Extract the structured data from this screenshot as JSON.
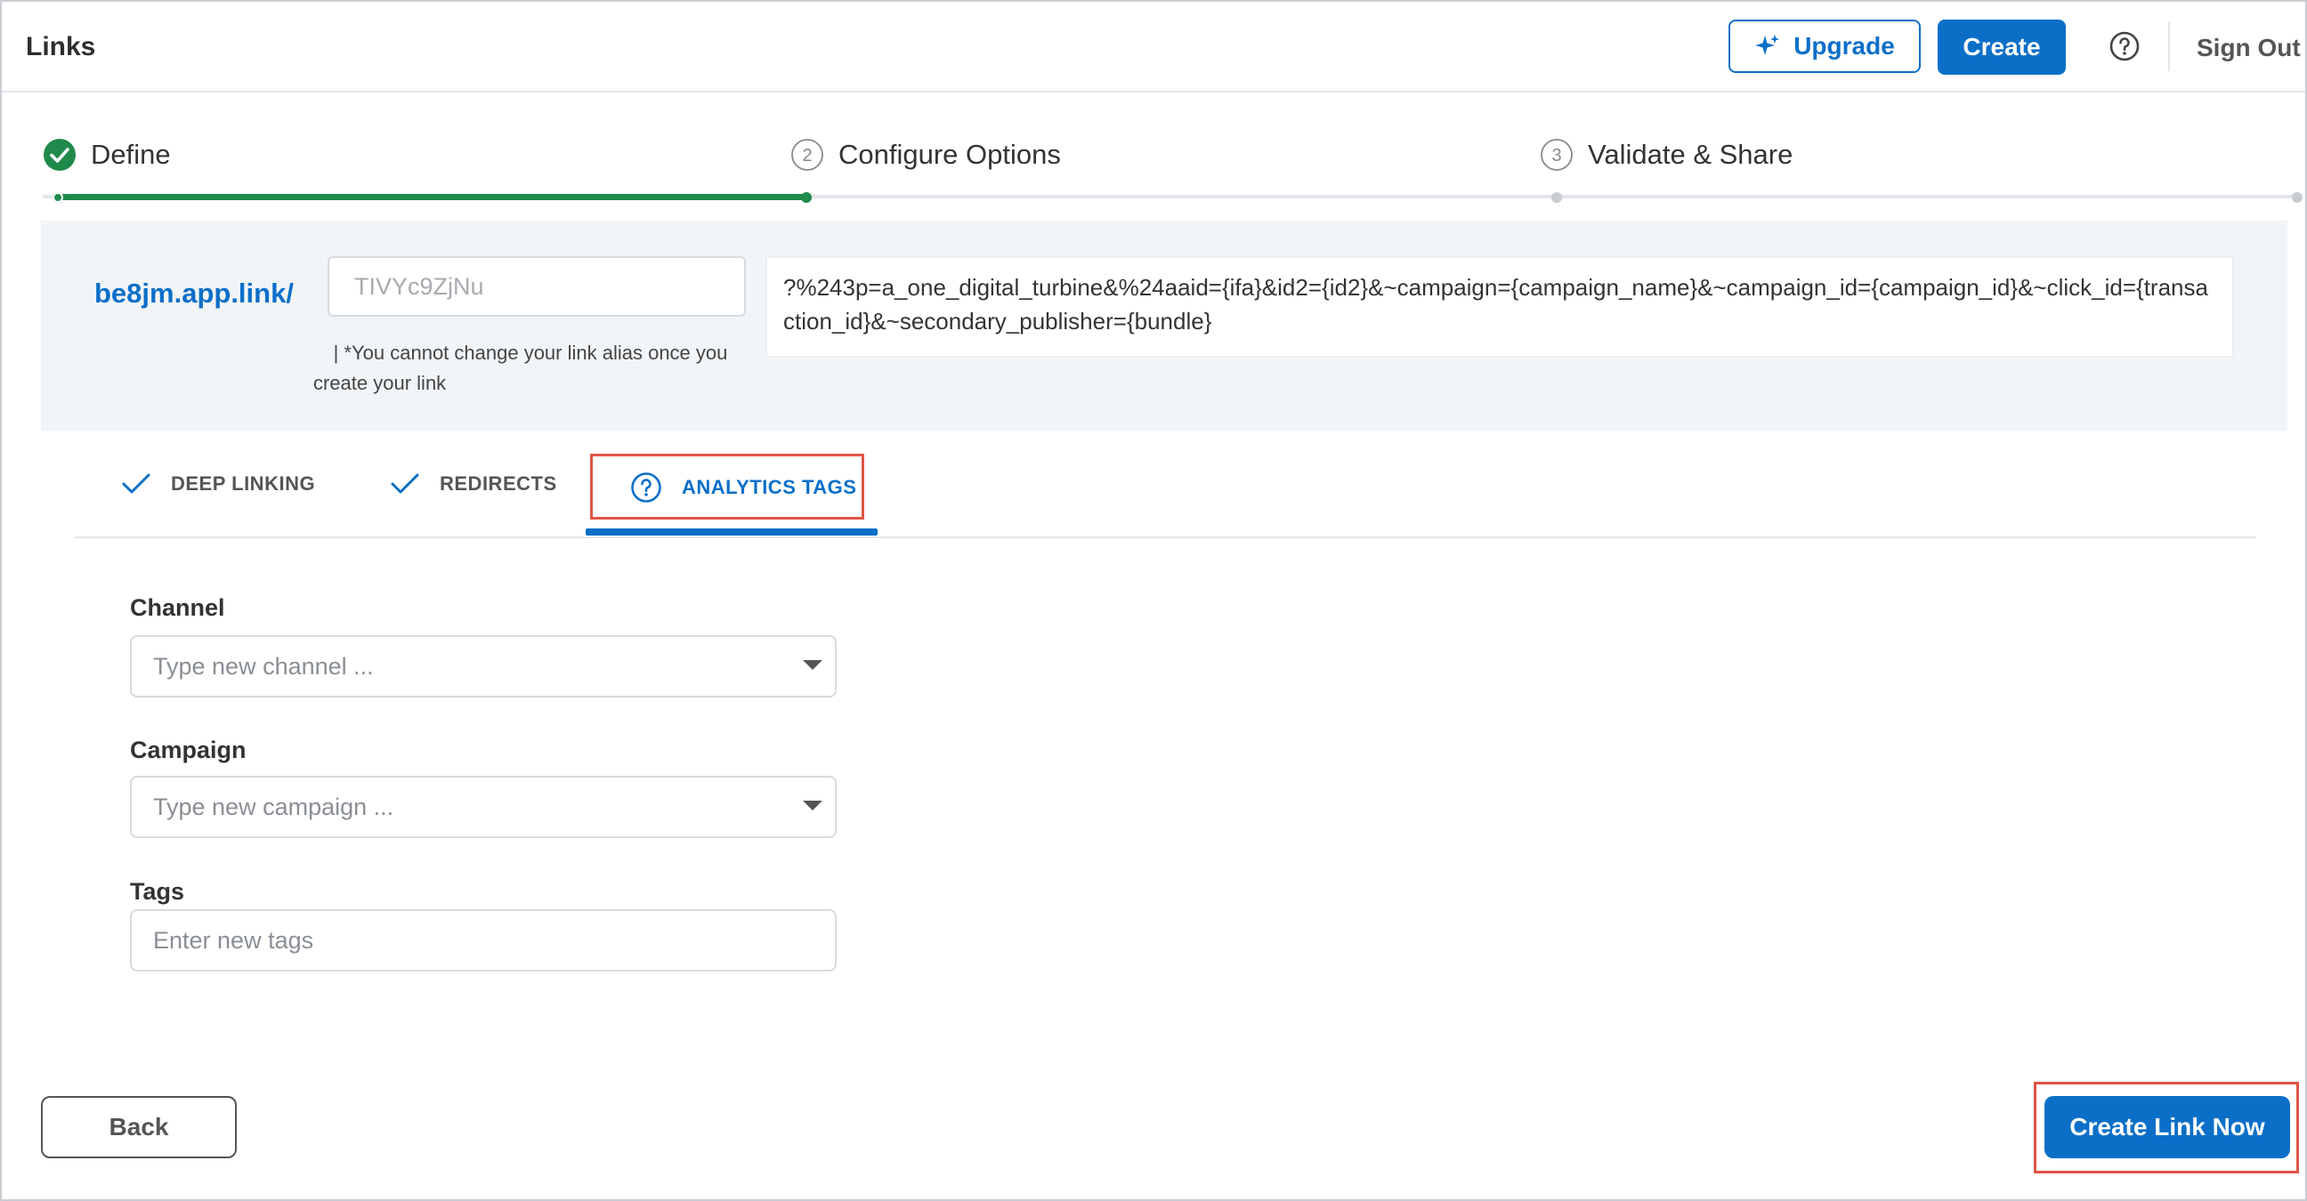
{
  "header": {
    "title": "Links",
    "upgrade_label": "Upgrade",
    "create_label": "Create",
    "sign_out_label": "Sign Out"
  },
  "stepper": {
    "steps": [
      {
        "label": "Define",
        "status": "complete"
      },
      {
        "label": "Configure Options",
        "number": "2",
        "status": "current"
      },
      {
        "label": "Validate & Share",
        "number": "3",
        "status": "pending"
      }
    ]
  },
  "link": {
    "domain": "be8jm.app.link/",
    "alias_placeholder": "TIVYc9ZjNu",
    "alias_note_line1": "| *You cannot change your link alias once you",
    "alias_note_line2": "create your link",
    "query_string": "?%243p=a_one_digital_turbine&%24aaid={ifa}&id2={id2}&~campaign={campaign_name}&~campaign_id={campaign_id}&~click_id={transaction_id}&~secondary_publisher={bundle}"
  },
  "tabs": [
    {
      "label": "DEEP LINKING",
      "icon": "check-icon",
      "state": "done"
    },
    {
      "label": "REDIRECTS",
      "icon": "check-icon",
      "state": "done"
    },
    {
      "label": "ANALYTICS TAGS",
      "icon": "help-icon",
      "state": "active"
    }
  ],
  "form": {
    "channel": {
      "label": "Channel",
      "placeholder": "Type new channel ..."
    },
    "campaign": {
      "label": "Campaign",
      "placeholder": "Type new campaign ..."
    },
    "tags": {
      "label": "Tags",
      "placeholder": "Enter new tags"
    }
  },
  "footer": {
    "back_label": "Back",
    "create_link_label": "Create Link Now"
  },
  "colors": {
    "brand_blue": "#0b6fc8",
    "success_green": "#1f8a4c",
    "highlight_red": "#e05545",
    "panel_bg": "#f2f5f8"
  }
}
